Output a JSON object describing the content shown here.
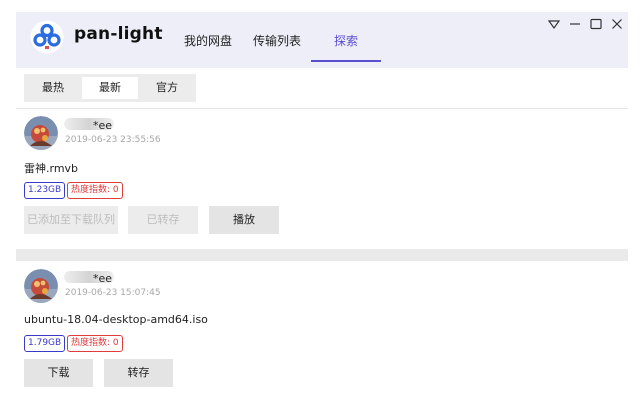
{
  "app": {
    "title": "pan-light"
  },
  "nav": {
    "tabs": [
      {
        "label": "我的网盘",
        "active": false
      },
      {
        "label": "传输列表",
        "active": false
      },
      {
        "label": "探索",
        "active": true
      }
    ],
    "accent_color": "#5a4fcf"
  },
  "window_controls": [
    "dropdown-icon",
    "minimize-icon",
    "maximize-icon",
    "close-icon"
  ],
  "subtabs": [
    {
      "label": "最热",
      "active": false
    },
    {
      "label": "最新",
      "active": true
    },
    {
      "label": "官方",
      "active": false
    }
  ],
  "posts": [
    {
      "username": "*ee",
      "time": "2019-06-23 23:55:56",
      "filename": "雷神.rmvb",
      "size": "1.23GB",
      "hot": "热度指数: 0",
      "buttons": [
        {
          "label": "已添加至下载队列",
          "disabled": true
        },
        {
          "label": "已转存",
          "disabled": true
        },
        {
          "label": "播放",
          "disabled": false
        }
      ]
    },
    {
      "username": "*ee",
      "time": "2019-06-23 15:07:45",
      "filename": "ubuntu-18.04-desktop-amd64.iso",
      "size": "1.79GB",
      "hot": "热度指数: 0",
      "buttons": [
        {
          "label": "下载",
          "disabled": false
        },
        {
          "label": "转存",
          "disabled": false
        }
      ]
    }
  ]
}
